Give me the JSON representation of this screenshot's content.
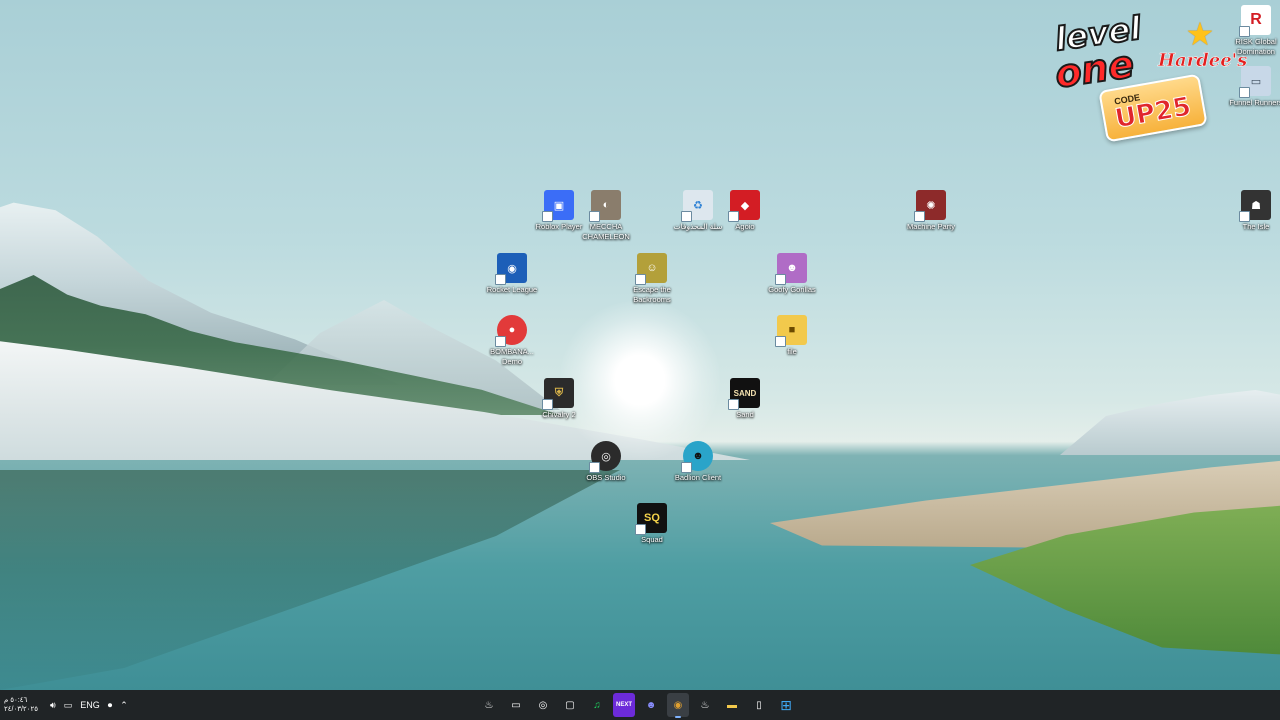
{
  "desktop": {
    "icons": [
      {
        "label": "Roblox Player",
        "icon": "roblox-icon",
        "color": "#3b6df7"
      },
      {
        "label": "MECCHA CHAMELEON",
        "icon": "meccha-icon",
        "color": "#8a7d6c"
      },
      {
        "label": "سلة المحذوفات",
        "icon": "recycle-bin-icon",
        "color": "#dde7ee"
      },
      {
        "label": "Agoio",
        "icon": "agoio-icon",
        "color": "#d31d24"
      },
      {
        "label": "Machine Party",
        "icon": "machine-party-icon",
        "color": "#8d2a2a"
      },
      {
        "label": "The Isle",
        "icon": "the-isle-icon",
        "color": "#333333"
      },
      {
        "label": "Rocket League",
        "icon": "rocket-league-icon",
        "color": "#1d5fb8"
      },
      {
        "label": "Escape the Backrooms",
        "icon": "escape-backrooms-icon",
        "color": "#b3a03a"
      },
      {
        "label": "Goofy Gorillas",
        "icon": "goofy-gorillas-icon",
        "color": "#b06cc6"
      },
      {
        "label": "BOMBANA... Demo",
        "icon": "bombana-icon",
        "color": "#e23a3a"
      },
      {
        "label": "file",
        "icon": "folder-icon",
        "color": "#f2c94c"
      },
      {
        "label": "Chivalry 2",
        "icon": "chivalry-icon",
        "color": "#2b2b2b"
      },
      {
        "label": "Sand",
        "icon": "sand-icon",
        "color": "#111111"
      },
      {
        "label": "OBS Studio",
        "icon": "obs-icon",
        "color": "#2b2b2b"
      },
      {
        "label": "Badlion Client",
        "icon": "badlion-icon",
        "color": "#2aa4c9"
      },
      {
        "label": "Squad",
        "icon": "squad-icon",
        "color": "#111111"
      },
      {
        "label": "RISK Global Domination",
        "icon": "risk-icon",
        "color": "#ffffff"
      },
      {
        "label": "Funnel Runners",
        "icon": "funnel-runners-icon",
        "color": "#c8d8e8"
      }
    ],
    "icon_glyphs": {
      "roblox": "▣",
      "meccha": "◐",
      "recycle": "♻",
      "agoio": "◆",
      "machine": "✺",
      "isle": "☗",
      "rocket": "◉",
      "backrooms": "☺",
      "gorillas": "☻",
      "bombana": "●",
      "folder": "■",
      "chivalry": "⛨",
      "sand": "SAND",
      "obs": "◎",
      "badlion": "☻",
      "squad": "SQ",
      "risk": "R",
      "funnel": "▭"
    }
  },
  "ads": {
    "level_one_line1": "level",
    "level_one_line2": "one",
    "hardees": "Hardee's",
    "code_label": "CODE",
    "code_value": "UP25"
  },
  "taskbar": {
    "clock_time": "٥٠:٤٦ م",
    "clock_date": "٢٤/٠٣/٢٠٢٥",
    "language": "ENG",
    "apps": [
      {
        "name": "steam",
        "glyph": "♨"
      },
      {
        "name": "terminal",
        "glyph": "▭"
      },
      {
        "name": "obs",
        "glyph": "◎"
      },
      {
        "name": "xbox",
        "glyph": "▢"
      },
      {
        "name": "spotify",
        "glyph": "♫",
        "color": "#1ed760"
      },
      {
        "name": "next",
        "glyph": "NEXT",
        "color": "#6c2bd9"
      },
      {
        "name": "discord",
        "glyph": "☻",
        "color": "#8a8fff"
      },
      {
        "name": "chrome",
        "glyph": "◉",
        "color": "#e0a030"
      },
      {
        "name": "steam-2",
        "glyph": "♨"
      },
      {
        "name": "file-explorer",
        "glyph": "▬",
        "color": "#f2c94c"
      },
      {
        "name": "notepad",
        "glyph": "▯"
      },
      {
        "name": "windows-start",
        "glyph": "⊞",
        "color": "#3fa9f5"
      }
    ]
  }
}
